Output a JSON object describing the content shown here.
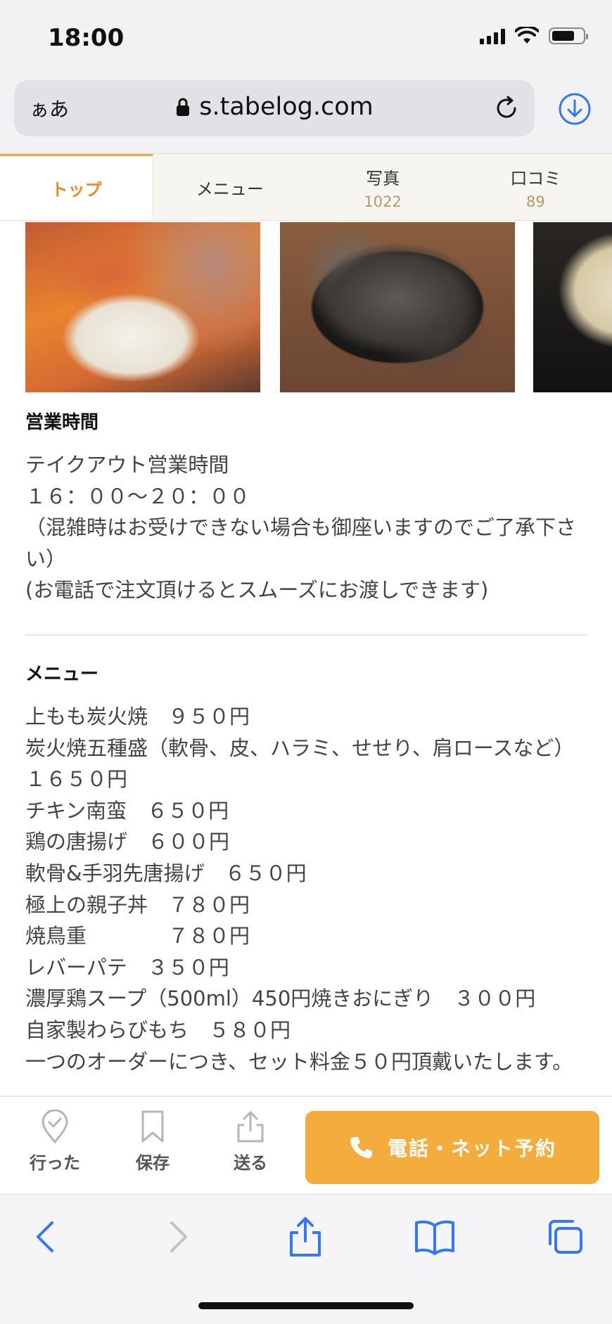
{
  "status": {
    "time": "18:00"
  },
  "browser": {
    "aa_label": "ぁあ",
    "url": "s.tabelog.com"
  },
  "tabs": [
    {
      "label": "トップ",
      "count": ""
    },
    {
      "label": "メニュー",
      "count": ""
    },
    {
      "label": "写真",
      "count": "1022"
    },
    {
      "label": "口コミ",
      "count": "89"
    }
  ],
  "hours": {
    "heading": "営業時間",
    "lines": [
      "テイクアウト営業時間",
      "１６：００〜２０：００",
      "（混雑時はお受けできない場合も御座いますのでご了承下さ",
      "い）",
      "(お電話で注文頂けるとスムーズにお渡しできます)"
    ]
  },
  "menu": {
    "heading": "メニュー",
    "lines": [
      "上もも炭火焼　９５０円",
      "炭火焼五種盛（軟骨、皮、ハラミ、せせり、肩ロースなど）",
      "１６５０円",
      "チキン南蛮　６５０円",
      "鶏の唐揚げ　６００円",
      "軟骨&手羽先唐揚げ　６５０円",
      "極上の親子丼　７８０円",
      "焼鳥重　　　　７８０円",
      "レバーパテ　３５０円",
      "濃厚鶏スープ（500ml）450円焼きおにぎり　３００円",
      "自家製わらびもち　５８０円",
      "一つのオーダーにつき、セット料金５０円頂戴いたします。"
    ]
  },
  "actions": {
    "went": "行った",
    "save": "保存",
    "send": "送る",
    "reserve": "電話・ネット予約"
  },
  "colors": {
    "accent": "#f4ad3d",
    "tab_active": "#e38e2b",
    "safari_blue": "#3478f6"
  }
}
